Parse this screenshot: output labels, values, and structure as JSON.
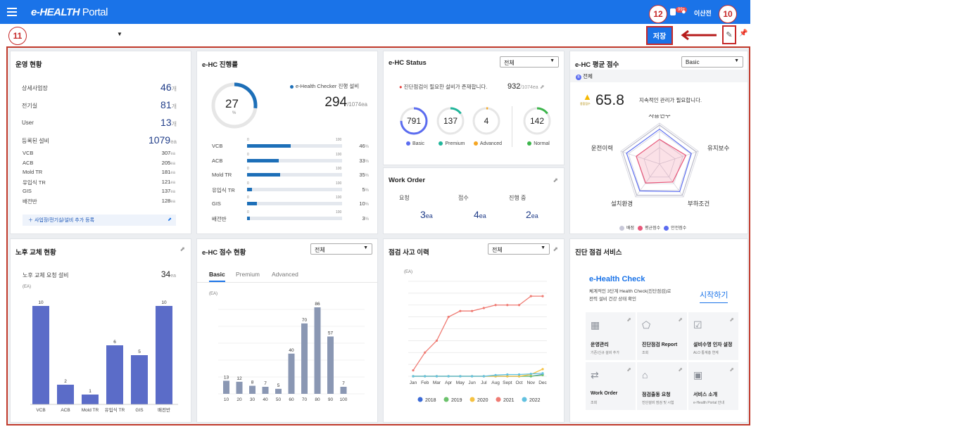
{
  "header": {
    "brand_main": "e-HEALTH",
    "brand_sub": "Portal",
    "notif_badge": "99+",
    "user_name": "이산전"
  },
  "annotations": {
    "n12": "12",
    "n10": "10",
    "n11": "11"
  },
  "toolbar": {
    "save_label": "저장"
  },
  "ops": {
    "title": "운영 현황",
    "rows": [
      {
        "label": "상세사업장",
        "value": "46",
        "unit": "개"
      },
      {
        "label": "전기실",
        "value": "81",
        "unit": "개"
      },
      {
        "label": "User",
        "value": "13",
        "unit": "개"
      },
      {
        "label": "등록된 설비",
        "value": "1079",
        "unit": "ea"
      }
    ],
    "details": [
      {
        "label": "VCB",
        "value": "307",
        "unit": "ea"
      },
      {
        "label": "ACB",
        "value": "205",
        "unit": "ea"
      },
      {
        "label": "Mold TR",
        "value": "181",
        "unit": "ea"
      },
      {
        "label": "유입식 TR",
        "value": "121",
        "unit": "ea"
      },
      {
        "label": "GIS",
        "value": "137",
        "unit": "ea"
      },
      {
        "label": "배전반",
        "value": "128",
        "unit": "ea"
      }
    ],
    "add_link": "사업장/전기실/설비 추가 등록"
  },
  "progress": {
    "title": "e-HC 진행률",
    "ring_value": "27",
    "ring_unit": "%",
    "ring_fraction": 0.27,
    "legend": "e-Health Checker 진행 설비",
    "count": "294",
    "total": "/1074ea",
    "tick0": "0",
    "tick100": "100",
    "bars": [
      {
        "label": "VCB",
        "pct": 46
      },
      {
        "label": "ACB",
        "pct": 33
      },
      {
        "label": "Mold TR",
        "pct": 35
      },
      {
        "label": "유입식 TR",
        "pct": 5
      },
      {
        "label": "GIS",
        "pct": 10
      },
      {
        "label": "배전반",
        "pct": 3
      }
    ],
    "pct_unit": "%"
  },
  "status": {
    "title": "e-HC Status",
    "select": "전체",
    "warning": "진단점검이 필요한 설비가 존재합니다.",
    "count": "932",
    "total": "/1074ea",
    "rings": [
      {
        "value": "791",
        "label": "Basic",
        "color": "#5b6cf0",
        "frac": 0.75
      },
      {
        "value": "137",
        "label": "Premium",
        "color": "#1fb59a",
        "frac": 0.15
      },
      {
        "value": "4",
        "label": "Advanced",
        "color": "#f5a623",
        "frac": 0.02
      },
      {
        "value": "142",
        "label": "Normal",
        "color": "#3bb54a",
        "frac": 0.15
      }
    ],
    "wo_title": "Work Order",
    "wo": [
      {
        "label": "요청",
        "value": "3",
        "unit": "ea"
      },
      {
        "label": "접수",
        "value": "4",
        "unit": "ea"
      },
      {
        "label": "진행 중",
        "value": "2",
        "unit": "ea"
      }
    ]
  },
  "score": {
    "title": "e-HC 평균 점수",
    "select": "Basic",
    "scope": "전체",
    "tag": "종합점수",
    "value": "65.8",
    "msg": "지속적인 관리가 필요합니다.",
    "axes": [
      "사용연수",
      "유지보수",
      "부하조건",
      "설치환경",
      "운전이력"
    ],
    "legend": [
      "배점",
      "평균점수",
      "안전점수"
    ],
    "colors": [
      "#c8c8d8",
      "#e8587a",
      "#5b6cf0"
    ]
  },
  "aging": {
    "title": "노후 교체 현황",
    "label": "노후 교체 요청 설비",
    "count": "34",
    "unit": "ea",
    "y_unit": "(EA)"
  },
  "hcscore": {
    "title": "e-HC 점수 현황",
    "select": "전체",
    "tabs": [
      "Basic",
      "Premium",
      "Advanced"
    ],
    "y_unit": "(EA)"
  },
  "history": {
    "title": "점검 사고 이력",
    "select": "전체",
    "y_unit": "(EA)"
  },
  "service": {
    "title": "진단 점검 서비스",
    "headline": "e-Health Check",
    "desc1": "체계적인 3단계 Health Check(진단점검)로",
    "desc2": "전력 설비 건강 상태 확인",
    "start": "시작하기",
    "items": [
      {
        "t": "운영관리",
        "s": "기존/신규 설비 추가",
        "i": "▦"
      },
      {
        "t": "진단점검 Report",
        "s": "조회",
        "i": "⬠"
      },
      {
        "t": "설비수명 인자 설정",
        "s": "ALO 통계총 연계",
        "i": "☑"
      },
      {
        "t": "Work Order",
        "s": "조회",
        "i": "⇄"
      },
      {
        "t": "점검출동 요청",
        "s": "진단설비 점검 및 시험",
        "i": "⌂"
      },
      {
        "t": "서비스 소개",
        "s": "e-Health Portal 안내",
        "i": "▣"
      }
    ]
  },
  "chart_data": [
    {
      "type": "bar",
      "title": "노후 교체 현황",
      "ylabel": "(EA)",
      "categories": [
        "VCB",
        "ACB",
        "Mold TR",
        "유입식 TR",
        "GIS",
        "배전반"
      ],
      "values": [
        10,
        2,
        1,
        6,
        5,
        10
      ],
      "ylim": [
        0,
        10
      ],
      "color": "#5b6cc8"
    },
    {
      "type": "bar",
      "title": "e-HC 점수 현황",
      "ylabel": "(EA)",
      "categories": [
        "10",
        "20",
        "30",
        "40",
        "50",
        "60",
        "70",
        "80",
        "90",
        "100"
      ],
      "values": [
        13,
        12,
        8,
        7,
        5,
        40,
        70,
        86,
        57,
        7
      ],
      "ylim": [
        0,
        86
      ],
      "color": "#8a97b3"
    },
    {
      "type": "line",
      "title": "점검 사고 이력",
      "ylabel": "(EA)",
      "categories": [
        "Jan",
        "Feb",
        "Mar",
        "Apr",
        "May",
        "Jun",
        "Jul",
        "Aug",
        "Sept",
        "Oct",
        "Nov",
        "Dec"
      ],
      "series": [
        {
          "name": "2018",
          "color": "#3b6ad6",
          "values": [
            0,
            0,
            0,
            0,
            0,
            0,
            0,
            0,
            0,
            0,
            0,
            0.3
          ]
        },
        {
          "name": "2019",
          "color": "#6cc26c",
          "values": [
            0,
            0,
            0,
            0,
            0,
            0,
            0,
            0,
            0,
            0,
            0,
            0.2
          ]
        },
        {
          "name": "2020",
          "color": "#f5c242",
          "values": [
            0,
            0,
            0,
            0,
            0,
            0,
            0,
            0,
            0,
            0,
            0.3,
            1.2
          ]
        },
        {
          "name": "2021",
          "color": "#ef7b73",
          "values": [
            1,
            4,
            6,
            10,
            11,
            11,
            11.5,
            12,
            12,
            12,
            13.5,
            13.5
          ]
        },
        {
          "name": "2022",
          "color": "#62c1e0",
          "values": [
            0,
            0,
            0,
            0,
            0,
            0,
            0,
            0.2,
            0.3,
            0.3,
            0.4,
            0.5
          ]
        }
      ],
      "ylim": [
        0,
        16
      ]
    }
  ]
}
